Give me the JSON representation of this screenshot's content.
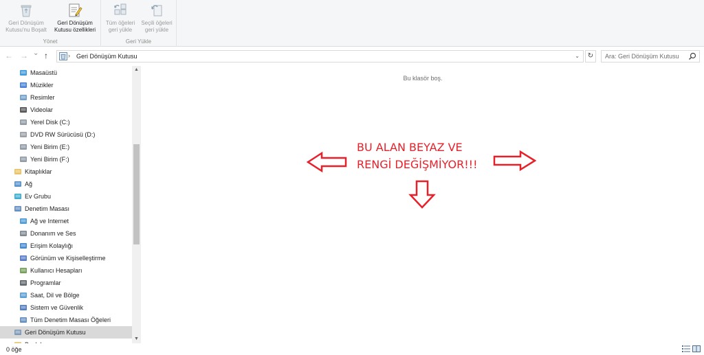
{
  "ribbon": {
    "groups": [
      {
        "label": "Yönet",
        "buttons": [
          {
            "line1": "Geri Dönüşüm",
            "line2": "Kutusu'nu Boşalt",
            "disabled": true
          },
          {
            "line1": "Geri Dönüşüm",
            "line2": "Kutusu özellikleri",
            "disabled": false
          }
        ]
      },
      {
        "label": "Geri Yükle",
        "buttons": [
          {
            "line1": "Tüm öğeleri",
            "line2": "geri yükle",
            "disabled": true
          },
          {
            "line1": "Seçili öğeleri",
            "line2": "geri yükle",
            "disabled": true
          }
        ]
      }
    ]
  },
  "nav": {
    "back": "←",
    "forward": "→",
    "recent": "⌄",
    "up": "↑"
  },
  "address": {
    "separator": "›",
    "crumb": "Geri Dönüşüm Kutusu",
    "dropdown": "⌄",
    "refresh": "↻"
  },
  "search": {
    "placeholder": "Ara: Geri Dönüşüm Kutusu"
  },
  "tree": [
    {
      "label": "Masaüstü",
      "icon": "desktop-icon"
    },
    {
      "label": "Müzikler",
      "icon": "music-icon"
    },
    {
      "label": "Resimler",
      "icon": "pictures-icon"
    },
    {
      "label": "Videolar",
      "icon": "videos-icon"
    },
    {
      "label": "Yerel Disk (C:)",
      "icon": "drive-icon"
    },
    {
      "label": "DVD RW Sürücüsü (D:)",
      "icon": "dvd-icon"
    },
    {
      "label": "Yeni Birim (E:)",
      "icon": "drive-icon"
    },
    {
      "label": "Yeni Birim (F:)",
      "icon": "drive-icon"
    },
    {
      "label": "Kitaplıklar",
      "icon": "libraries-icon"
    },
    {
      "label": "Ağ",
      "icon": "network-icon"
    },
    {
      "label": "Ev Grubu",
      "icon": "homegroup-icon"
    },
    {
      "label": "Denetim Masası",
      "icon": "control-panel-icon"
    },
    {
      "label": "Ağ ve Internet",
      "icon": "network-internet-icon"
    },
    {
      "label": "Donanım ve Ses",
      "icon": "hardware-sound-icon"
    },
    {
      "label": "Erişim Kolaylığı",
      "icon": "ease-of-access-icon"
    },
    {
      "label": "Görünüm ve Kişiselleştirme",
      "icon": "appearance-icon"
    },
    {
      "label": "Kullanıcı Hesapları",
      "icon": "user-accounts-icon"
    },
    {
      "label": "Programlar",
      "icon": "programs-icon"
    },
    {
      "label": "Saat, Dil ve Bölge",
      "icon": "clock-region-icon"
    },
    {
      "label": "Sistem ve Güvenlik",
      "icon": "system-security-icon"
    },
    {
      "label": "Tüm Denetim Masası Öğeleri",
      "icon": "all-control-panel-icon"
    },
    {
      "label": "Geri Dönüşüm Kutusu",
      "icon": "recycle-bin-icon",
      "selected": true
    },
    {
      "label": "Baskılar",
      "icon": "folder-icon"
    }
  ],
  "content": {
    "empty_message": "Bu klasör boş.",
    "annotation_line1": "BU ALAN BEYAZ VE",
    "annotation_line2": "RENGİ DEĞİŞMİYOR!!!"
  },
  "status": {
    "count": "0 öğe"
  },
  "colors": {
    "annotation": "#e8202a",
    "selection": "#d9d9d9"
  }
}
